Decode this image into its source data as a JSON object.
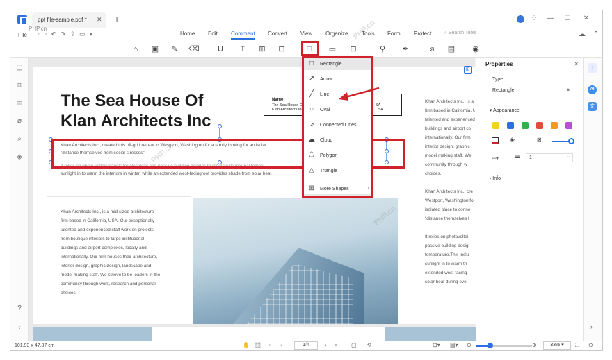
{
  "window": {
    "tab_title": "ppt file-sample.pdf *",
    "tab_close": "✕",
    "tab_add": "+",
    "watermark": "PHP.cn",
    "controls": {
      "minimize": "—",
      "maximize": "☐",
      "close": "✕"
    }
  },
  "menubar": {
    "file": "File",
    "items": [
      "Home",
      "Edit",
      "Comment",
      "Convert",
      "View",
      "Organize",
      "Tools",
      "Form",
      "Protect"
    ],
    "active": "Comment",
    "search": "Search Tools"
  },
  "shape_menu": {
    "items": [
      {
        "label": "Rectangle",
        "icon": "rectangle-icon"
      },
      {
        "label": "Arrow",
        "icon": "arrow-icon"
      },
      {
        "label": "Line",
        "icon": "line-icon"
      },
      {
        "label": "Oval",
        "icon": "oval-icon"
      },
      {
        "label": "Connected Lines",
        "icon": "connected-lines-icon"
      },
      {
        "label": "Cloud",
        "icon": "cloud-icon"
      },
      {
        "label": "Polygon",
        "icon": "polygon-icon"
      },
      {
        "label": "Triangle",
        "icon": "triangle-icon"
      },
      {
        "label": "More Shapes",
        "icon": "more-shapes-icon"
      }
    ]
  },
  "document": {
    "title_line1": "The Sea House Of",
    "title_line2": "Klan Architects Inc",
    "intro_line1": "Khan Architects Inc., created this off-grid retreat in Westport, Washington for a family looking for an isolat",
    "intro_line2": "\"distance themselves from social stresses\".",
    "intro_line3": "It relies on photo-voltaic panels for electricity and passive building designs to regulate its internal tempe",
    "intro_line4": "sunlight in to warm the interiors in winter, while an extended west-facingroof provides shade from solar heat",
    "namebox": {
      "col1_title": "Name",
      "col1_l1": "The Sea House Of",
      "col1_l2": "Klan Architects Inc",
      "col2_l1": "SA",
      "col2_l2": "USA"
    },
    "left_col": [
      "Khan Architects Inc., is a mid-sized architecture",
      "firm based in California, USA. Our exceptionally",
      "talented and experienced staff work on projects",
      "from boutique interiors to large institutional",
      "buildings and airport complexes, locally and",
      "internationally. Our firm houses their architecture,",
      "interior design, graphic design, landscape and",
      "model making staff. We strieve to be leaders in the",
      "community through work, research and personal",
      "choices."
    ],
    "right_col": [
      "Khan Architects Inc., is a mid-",
      "firm based in California, USA.",
      "talented and experienced sta",
      "buildings and airport co",
      "internationally. Our firm",
      "interior design, graphic",
      "model making staff. We",
      "community through w",
      "choices.",
      "",
      "Khan Architects Inc., cre",
      "Westport, Washington fo",
      "isolated place to conne",
      "\"distance themselves f",
      "",
      "It relies on photovoltai",
      "passive building desig",
      "temperature.This inclu",
      "sunlight in to warm th",
      "extended west-facing",
      "solar heat during eve"
    ]
  },
  "properties": {
    "header": "Properties",
    "type_label": "Type",
    "type_value": "Rectangle",
    "appearance": "Appearance",
    "swatches": [
      "#f2d21b",
      "#2f6fe4",
      "#2fb24a",
      "#e24a3b",
      "#f29a1b",
      "#b94fd8"
    ],
    "stroke_width": "1",
    "info": "Info"
  },
  "statusbar": {
    "dimensions": "101.93 x 47.87 cm",
    "page": "1",
    "page_total": "/4",
    "zoom": "33%"
  }
}
